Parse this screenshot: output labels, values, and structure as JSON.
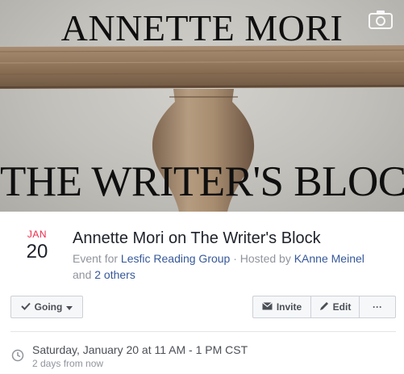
{
  "cover": {
    "title_top": "ANNETTE MORI",
    "title_bottom": "THE WRITER'S BLOCK",
    "camera_icon": "camera-icon"
  },
  "event": {
    "month": "JAN",
    "day": "20",
    "title": "Annette Mori on The Writer's Block",
    "meta_prefix": "Event for ",
    "group": "Lesfic Reading Group",
    "meta_mid": " · Hosted by ",
    "host": "KAnne Meinel",
    "meta_and": " and ",
    "others": "2 others"
  },
  "actions": {
    "going_label": "Going",
    "invite_label": "Invite",
    "edit_label": "Edit",
    "more_label": "···"
  },
  "time": {
    "main": "Saturday, January 20 at 11 AM - 1 PM CST",
    "sub": "2 days from now"
  },
  "colors": {
    "month_red": "#f02849",
    "link_blue": "#365899",
    "muted": "#90949c"
  }
}
